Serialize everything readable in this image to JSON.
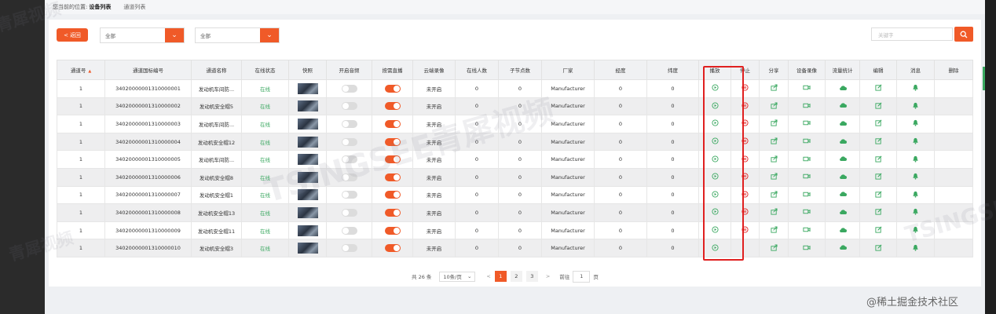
{
  "breadcrumb": {
    "label": "您当前的位置:",
    "current": "设备列表",
    "tab": "通道列表"
  },
  "toolbar": {
    "back_label": "返回",
    "filter1_value": "全部",
    "filter2_value": "全部",
    "search_placeholder": "关键字"
  },
  "table": {
    "headers": [
      "通道号",
      "通道国标编号",
      "通道名称",
      "在线状态",
      "快照",
      "开启音频",
      "按需直播",
      "云端录像",
      "在线人数",
      "子节点数",
      "厂家",
      "经度",
      "纬度",
      "播放",
      "停止",
      "分享",
      "设备录像",
      "流量统计",
      "编辑",
      "消息",
      "删除"
    ],
    "rows": [
      {
        "no": "1",
        "gb": "34020000001310000001",
        "name": "发动机车间防...",
        "status": "在线",
        "audio": false,
        "live": true,
        "cloud": "未开启",
        "online": "0",
        "children": "0",
        "maker": "Manufacturer",
        "lng": "0",
        "lat": "0",
        "stop": true
      },
      {
        "no": "1",
        "gb": "34020000001310000002",
        "name": "发动机安全帽5",
        "status": "在线",
        "audio": false,
        "live": true,
        "cloud": "未开启",
        "online": "0",
        "children": "0",
        "maker": "Manufacturer",
        "lng": "0",
        "lat": "0",
        "stop": true
      },
      {
        "no": "1",
        "gb": "34020000001310000003",
        "name": "发动机车间防...",
        "status": "在线",
        "audio": false,
        "live": true,
        "cloud": "未开启",
        "online": "0",
        "children": "0",
        "maker": "Manufacturer",
        "lng": "0",
        "lat": "0",
        "stop": true
      },
      {
        "no": "1",
        "gb": "34020000001310000004",
        "name": "发动机安全帽12",
        "status": "在线",
        "audio": false,
        "live": true,
        "cloud": "未开启",
        "online": "0",
        "children": "0",
        "maker": "Manufacturer",
        "lng": "0",
        "lat": "0",
        "stop": true
      },
      {
        "no": "1",
        "gb": "34020000001310000005",
        "name": "发动机车间防...",
        "status": "在线",
        "audio": false,
        "live": true,
        "cloud": "未开启",
        "online": "0",
        "children": "0",
        "maker": "Manufacturer",
        "lng": "0",
        "lat": "0",
        "stop": true
      },
      {
        "no": "1",
        "gb": "34020000001310000006",
        "name": "发动机安全帽8",
        "status": "在线",
        "audio": false,
        "live": true,
        "cloud": "未开启",
        "online": "0",
        "children": "0",
        "maker": "Manufacturer",
        "lng": "0",
        "lat": "0",
        "stop": true
      },
      {
        "no": "1",
        "gb": "34020000001310000007",
        "name": "发动机安全帽1",
        "status": "在线",
        "audio": false,
        "live": true,
        "cloud": "未开启",
        "online": "0",
        "children": "0",
        "maker": "Manufacturer",
        "lng": "0",
        "lat": "0",
        "stop": true
      },
      {
        "no": "1",
        "gb": "34020000001310000008",
        "name": "发动机安全帽13",
        "status": "在线",
        "audio": false,
        "live": true,
        "cloud": "未开启",
        "online": "0",
        "children": "0",
        "maker": "Manufacturer",
        "lng": "0",
        "lat": "0",
        "stop": true
      },
      {
        "no": "1",
        "gb": "34020000001310000009",
        "name": "发动机安全帽11",
        "status": "在线",
        "audio": false,
        "live": true,
        "cloud": "未开启",
        "online": "0",
        "children": "0",
        "maker": "Manufacturer",
        "lng": "0",
        "lat": "0",
        "stop": true
      },
      {
        "no": "1",
        "gb": "34020000001310000010",
        "name": "发动机安全帽3",
        "status": "在线",
        "audio": false,
        "live": true,
        "cloud": "未开启",
        "online": "0",
        "children": "0",
        "maker": "Manufacturer",
        "lng": "0",
        "lat": "0",
        "stop": false
      }
    ]
  },
  "pagination": {
    "total": "共 26 条",
    "page_size": "10条/页",
    "pages": [
      "1",
      "2",
      "3"
    ],
    "current": "1",
    "goto_label": "前往",
    "goto_value": "1",
    "page_suffix": "页"
  },
  "watermarks": [
    "青犀视频",
    "TSINGSEE青犀视频",
    "青犀视频",
    "TSINGSEE"
  ],
  "corner_text": "@稀土掘金技术社区",
  "colors": {
    "accent": "#f05a28",
    "online": "#3aa860",
    "play_icon": "#3aa860",
    "stop_icon": "#e02020",
    "highlight": "#e02020"
  },
  "icons": {
    "back": "chevron-left-icon",
    "search": "search-icon",
    "play": "play-circle-icon",
    "stop": "stop-circle-icon",
    "share": "share-icon",
    "record": "video-camera-icon",
    "traffic": "cloud-stats-icon",
    "edit": "edit-icon",
    "message": "bell-icon"
  }
}
